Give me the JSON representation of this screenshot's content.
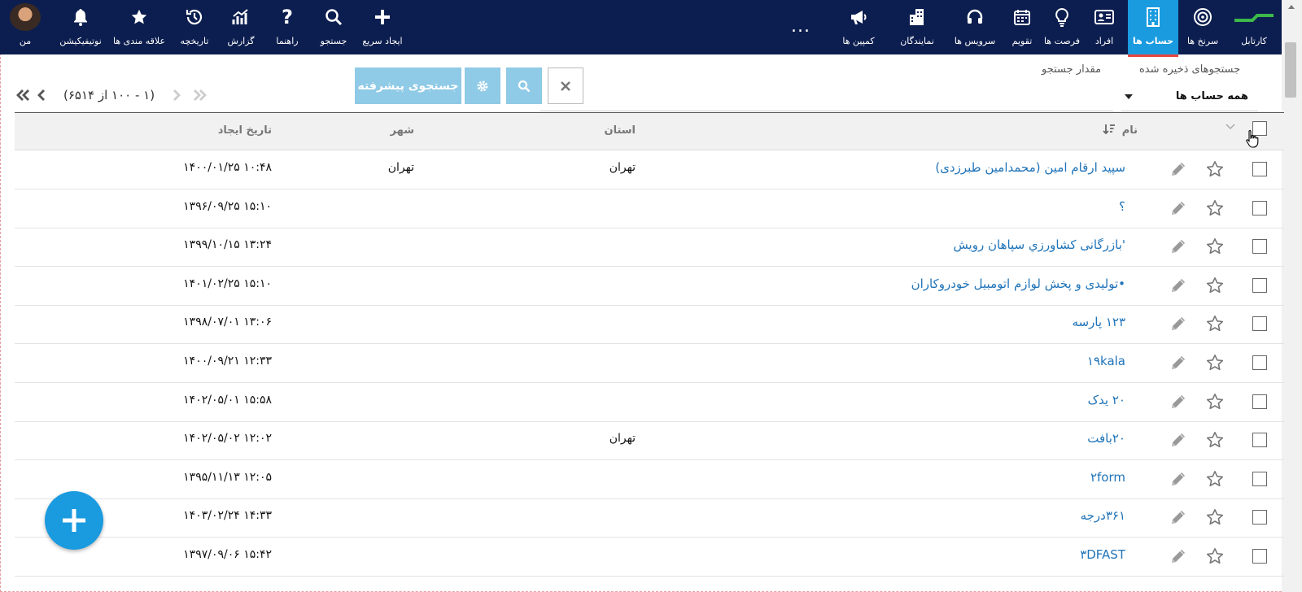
{
  "topbar": {
    "me_label": "من",
    "items": [
      {
        "key": "notifications",
        "label": "نوتیفیکیشن",
        "icon": "bell-icon"
      },
      {
        "key": "favorites",
        "label": "علاقه مندی ها",
        "icon": "star-icon"
      },
      {
        "key": "history",
        "label": "تاریخچه",
        "icon": "history-icon"
      },
      {
        "key": "report",
        "label": "گزارش",
        "icon": "chart-icon"
      },
      {
        "key": "help",
        "label": "راهنما",
        "icon": "question-icon"
      },
      {
        "key": "search",
        "label": "جستجو",
        "icon": "search-icon"
      },
      {
        "key": "quick_create",
        "label": "ایجاد سریع",
        "icon": "plus-icon"
      },
      {
        "key": "campaigns",
        "label": "کمپین ها",
        "icon": "megaphone-icon"
      },
      {
        "key": "agents",
        "label": "نمایندگان",
        "icon": "buildings-icon"
      },
      {
        "key": "service",
        "label": "سرویس ها",
        "icon": "headset-icon"
      },
      {
        "key": "calendar",
        "label": "تقویم",
        "icon": "calendar-icon"
      },
      {
        "key": "opportunities",
        "label": "فرصت ها",
        "icon": "lightbulb-icon"
      },
      {
        "key": "people",
        "label": "افراد",
        "icon": "contact-card-icon"
      },
      {
        "key": "accounts",
        "label": "حساب ها",
        "icon": "building-icon",
        "active": true
      },
      {
        "key": "measures",
        "label": "سرنخ ها",
        "icon": "target-icon"
      },
      {
        "key": "kartable",
        "label": "کارتابل",
        "icon": "logo-icon"
      }
    ],
    "more": "..."
  },
  "search": {
    "saved_label": "جستجوهای ذخیره شده",
    "saved_value": "همه حساب ها",
    "value_label": "مقدار جستجو",
    "value_placeholder": "",
    "advanced_label": "جستجوی پیشرفته"
  },
  "pager": {
    "info": "(۱ - ۱۰۰ از ۶۵۱۴)"
  },
  "table": {
    "headers": {
      "name": "نام",
      "province": "استان",
      "city": "شهر",
      "created": "تاریخ ایجاد"
    },
    "rows": [
      {
        "name": "سپید ارقام امین (محمدامین طبرزدی)",
        "province": "تهران",
        "city": "تهران",
        "created": "۱۴۰۰/۰۱/۲۵ ۱۰:۴۸"
      },
      {
        "name": "؟",
        "province": "",
        "city": "",
        "created": "۱۳۹۶/۰۹/۲۵ ۱۵:۱۰"
      },
      {
        "name": "'بازرگانی کشاورزي سپاهان رويش",
        "province": "",
        "city": "",
        "created": "۱۳۹۹/۱۰/۱۵ ۱۳:۲۴"
      },
      {
        "name": "•تولیدی و پخش لوازم اتومبیل خودروکاران",
        "province": "",
        "city": "",
        "created": "۱۴۰۱/۰۲/۲۵ ۱۵:۱۰"
      },
      {
        "name": "۱۲۳ پارسه",
        "province": "",
        "city": "",
        "created": "۱۳۹۸/۰۷/۰۱ ۱۳:۰۶"
      },
      {
        "name": "۱۹kala",
        "province": "",
        "city": "",
        "created": "۱۴۰۰/۰۹/۲۱ ۱۲:۳۳"
      },
      {
        "name": "۲۰ یدک",
        "province": "",
        "city": "",
        "created": "۱۴۰۲/۰۵/۰۱ ۱۵:۵۸"
      },
      {
        "name": "۲۰بافت",
        "province": "تهران",
        "city": "",
        "created": "۱۴۰۲/۰۵/۰۲ ۱۲:۰۲"
      },
      {
        "name": "۲form",
        "province": "",
        "city": "",
        "created": "۱۳۹۵/۱۱/۱۳ ۱۲:۰۵"
      },
      {
        "name": "۳۶۱درجه",
        "province": "",
        "city": "",
        "created": "۱۴۰۳/۰۲/۲۴ ۱۴:۳۳"
      },
      {
        "name": "۳DFAST",
        "province": "",
        "city": "",
        "created": "۱۳۹۷/۰۹/۰۶ ۱۵:۴۲"
      }
    ]
  },
  "colors": {
    "navbar": "#0c1e4f",
    "accent": "#1a9be0",
    "link": "#1f73b8",
    "button_light": "#8fcae6",
    "active_underline": "#e8453c"
  }
}
